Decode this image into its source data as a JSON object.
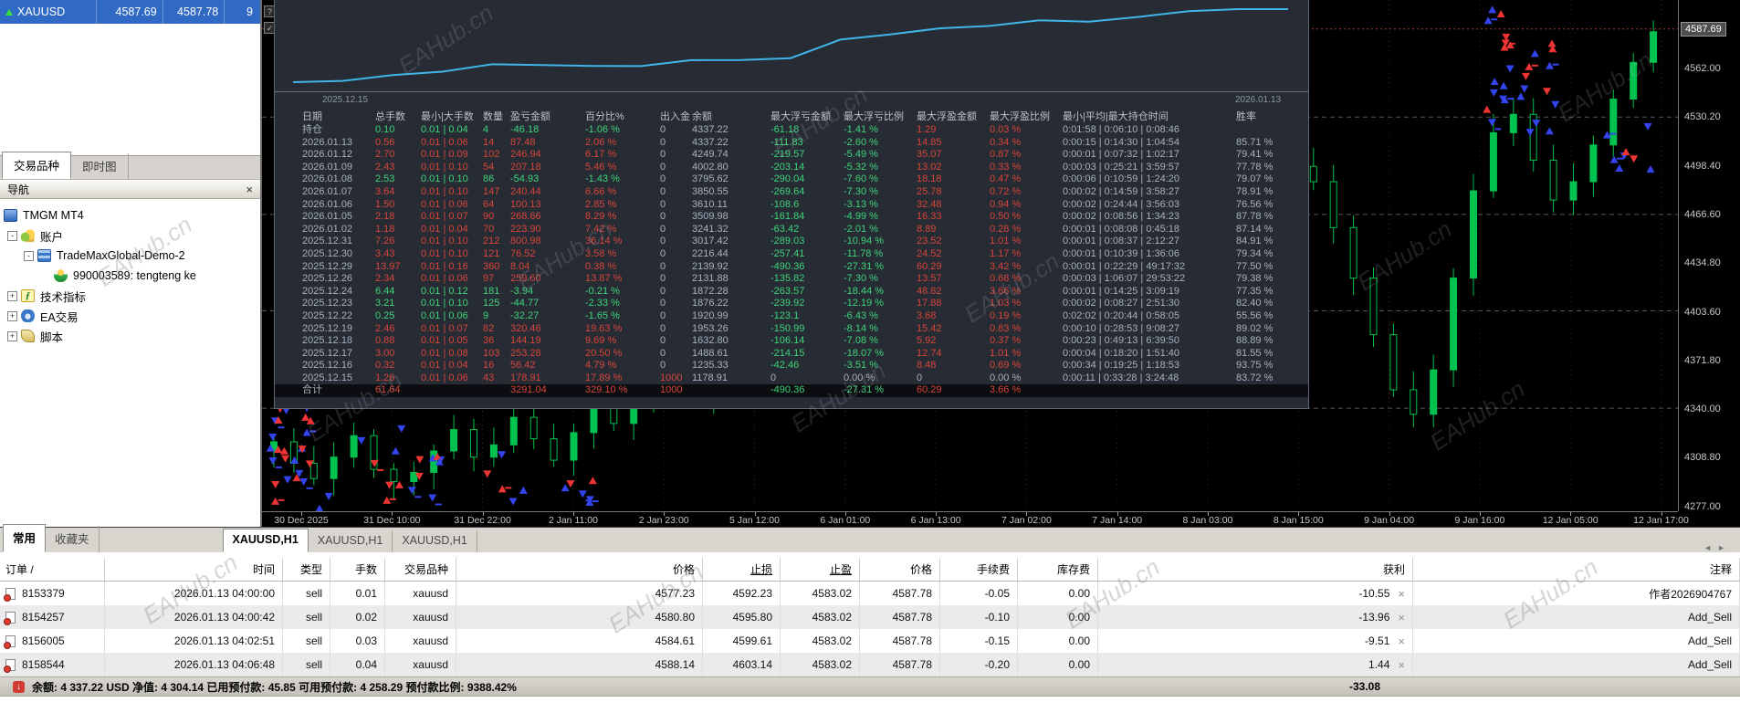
{
  "app": {
    "watermark": "EAHub.cn"
  },
  "market_watch": {
    "symbol": "XAUUSD",
    "bid": "4587.69",
    "ask": "4587.78",
    "spread": "9",
    "tabs": [
      {
        "label": "交易品种",
        "active": true
      },
      {
        "label": "即时图",
        "active": false
      }
    ]
  },
  "navigator": {
    "title": "导航",
    "close": "×",
    "tree": [
      {
        "label": "TMGM MT4",
        "icon": "platform-icon",
        "level": 0,
        "expander": ""
      },
      {
        "label": "账户",
        "icon": "accounts-icon",
        "level": 1,
        "expander": "-"
      },
      {
        "label": "TradeMaxGlobal-Demo-2",
        "icon": "server-icon",
        "level": 2,
        "expander": "-"
      },
      {
        "label": "990003589: tengteng ke",
        "icon": "account-icon",
        "level": 3,
        "expander": ""
      },
      {
        "label": "技术指标",
        "icon": "indicators-icon",
        "level": 1,
        "expander": "+"
      },
      {
        "label": "EA交易",
        "icon": "experts-icon",
        "level": 1,
        "expander": "+"
      },
      {
        "label": "脚本",
        "icon": "scripts-icon",
        "level": 1,
        "expander": "+"
      }
    ]
  },
  "tab_bar": {
    "left_tabs": [
      {
        "label": "常用",
        "active": true
      },
      {
        "label": "收藏夹",
        "active": false
      }
    ],
    "chart_tabs": [
      {
        "label": "XAUUSD,H1",
        "active": true
      },
      {
        "label": "XAUUSD,H1",
        "active": false
      },
      {
        "label": "XAUUSD,H1",
        "active": false
      }
    ],
    "scroll_left": "◄",
    "scroll_right": "►"
  },
  "stats_panel": {
    "start_date": "2025.12.15",
    "end_date": "2026.01.13",
    "headers": [
      "日期",
      "总手数",
      "最小|大手数",
      "数量",
      "盈亏金额",
      "百分比%",
      "出入金",
      "余额",
      "最大浮亏金额",
      "最大浮亏比例",
      "最大浮盈金额",
      "最大浮盈比例",
      "最小|平均|最大持仓时间",
      "胜率"
    ],
    "rows": [
      {
        "date": "持仓",
        "lots": "0.10",
        "minmax": "0.01 | 0.04",
        "cnt": "4",
        "pl": "-46.18",
        "pct": "-1.06 %",
        "io": "0",
        "bal": "4337.22",
        "mdd": "-61.18",
        "mddp": "-1.41 %",
        "mfp": "1.29",
        "mfpp": "0.03 %",
        "time": "0:01:58 | 0:06:10 | 0:08:46",
        "win": "",
        "cls": "loss"
      },
      {
        "date": "2026.01.13",
        "lots": "0.56",
        "minmax": "0.01 | 0.06",
        "cnt": "14",
        "pl": "87.48",
        "pct": "2.06 %",
        "io": "0",
        "bal": "4337.22",
        "mdd": "-111.83",
        "mddp": "-2.60 %",
        "mfp": "14.85",
        "mfpp": "0.34 %",
        "time": "0:00:15 | 0:14:30 | 1:04:54",
        "win": "85.71 %",
        "cls": "profit"
      },
      {
        "date": "2026.01.12",
        "lots": "2.70",
        "minmax": "0.01 | 0.09",
        "cnt": "102",
        "pl": "246.94",
        "pct": "6.17 %",
        "io": "0",
        "bal": "4249.74",
        "mdd": "-219.57",
        "mddp": "-5.49 %",
        "mfp": "35.07",
        "mfpp": "0.87 %",
        "time": "0:00:01 | 0:07:32 | 1:02:17",
        "win": "79.41 %",
        "cls": "profit"
      },
      {
        "date": "2026.01.09",
        "lots": "2.43",
        "minmax": "0.01 | 0.10",
        "cnt": "54",
        "pl": "207.18",
        "pct": "5.46 %",
        "io": "0",
        "bal": "4002.80",
        "mdd": "-203.14",
        "mddp": "-5.32 %",
        "mfp": "13.02",
        "mfpp": "0.33 %",
        "time": "0:00:03 | 0:25:21 | 3:59:57",
        "win": "77.78 %",
        "cls": "profit"
      },
      {
        "date": "2026.01.08",
        "lots": "2.53",
        "minmax": "0.01 | 0.10",
        "cnt": "86",
        "pl": "-54.93",
        "pct": "-1.43 %",
        "io": "0",
        "bal": "3795.62",
        "mdd": "-290.04",
        "mddp": "-7.60 %",
        "mfp": "18.18",
        "mfpp": "0.47 %",
        "time": "0:00:06 | 0:10:59 | 1:24:20",
        "win": "79.07 %",
        "cls": "loss"
      },
      {
        "date": "2026.01.07",
        "lots": "3.64",
        "minmax": "0.01 | 0.10",
        "cnt": "147",
        "pl": "240.44",
        "pct": "6.66 %",
        "io": "0",
        "bal": "3850.55",
        "mdd": "-269.64",
        "mddp": "-7.30 %",
        "mfp": "25.78",
        "mfpp": "0.72 %",
        "time": "0:00:02 | 0:14:59 | 3:58:27",
        "win": "78.91 %",
        "cls": "profit"
      },
      {
        "date": "2026.01.06",
        "lots": "1.50",
        "minmax": "0.01 | 0.06",
        "cnt": "64",
        "pl": "100.13",
        "pct": "2.85 %",
        "io": "0",
        "bal": "3610.11",
        "mdd": "-108.6",
        "mddp": "-3.13 %",
        "mfp": "32.48",
        "mfpp": "0.94 %",
        "time": "0:00:02 | 0:24:44 | 3:56:03",
        "win": "76.56 %",
        "cls": "profit"
      },
      {
        "date": "2026.01.05",
        "lots": "2.18",
        "minmax": "0.01 | 0.07",
        "cnt": "90",
        "pl": "268.66",
        "pct": "8.29 %",
        "io": "0",
        "bal": "3509.98",
        "mdd": "-161.84",
        "mddp": "-4.99 %",
        "mfp": "16.33",
        "mfpp": "0.50 %",
        "time": "0:00:02 | 0:08:56 | 1:34:23",
        "win": "87.78 %",
        "cls": "profit"
      },
      {
        "date": "2026.01.02",
        "lots": "1.18",
        "minmax": "0.01 | 0.04",
        "cnt": "70",
        "pl": "223.90",
        "pct": "7.42 %",
        "io": "0",
        "bal": "3241.32",
        "mdd": "-63.42",
        "mddp": "-2.01 %",
        "mfp": "8.89",
        "mfpp": "0.28 %",
        "time": "0:00:01 | 0:08:08 | 0:45:18",
        "win": "87.14 %",
        "cls": "profit"
      },
      {
        "date": "2025.12.31",
        "lots": "7.26",
        "minmax": "0.01 | 0.10",
        "cnt": "212",
        "pl": "800.98",
        "pct": "36.14 %",
        "io": "0",
        "bal": "3017.42",
        "mdd": "-289.03",
        "mddp": "-10.94 %",
        "mfp": "23.52",
        "mfpp": "1.01 %",
        "time": "0:00:01 | 0:08:37 | 2:12:27",
        "win": "84.91 %",
        "cls": "profit"
      },
      {
        "date": "2025.12.30",
        "lots": "3.43",
        "minmax": "0.01 | 0.10",
        "cnt": "121",
        "pl": "76.52",
        "pct": "3.58 %",
        "io": "0",
        "bal": "2216.44",
        "mdd": "-257.41",
        "mddp": "-11.78 %",
        "mfp": "24.52",
        "mfpp": "1.17 %",
        "time": "0:00:01 | 0:10:39 | 1:36:06",
        "win": "79.34 %",
        "cls": "profit"
      },
      {
        "date": "2025.12.29",
        "lots": "13.97",
        "minmax": "0.01 | 0.16",
        "cnt": "360",
        "pl": "8.04",
        "pct": "0.38 %",
        "io": "0",
        "bal": "2139.92",
        "mdd": "-490.36",
        "mddp": "-27.31 %",
        "mfp": "60.29",
        "mfpp": "3.42 %",
        "time": "0:00:01 | 0:22:29 | 49:17:32",
        "win": "77.50 %",
        "cls": "profit"
      },
      {
        "date": "2025.12.26",
        "lots": "2.34",
        "minmax": "0.01 | 0.06",
        "cnt": "97",
        "pl": "259.60",
        "pct": "13.87 %",
        "io": "0",
        "bal": "2131.88",
        "mdd": "-135.82",
        "mddp": "-7.30 %",
        "mfp": "13.57",
        "mfpp": "0.68 %",
        "time": "0:00:03 | 1:06:07 | 29:53:22",
        "win": "79.38 %",
        "cls": "profit"
      },
      {
        "date": "2025.12.24",
        "lots": "6.44",
        "minmax": "0.01 | 0.12",
        "cnt": "181",
        "pl": "-3.94",
        "pct": "-0.21 %",
        "io": "0",
        "bal": "1872.28",
        "mdd": "-263.57",
        "mddp": "-18.44 %",
        "mfp": "48.82",
        "mfpp": "3.66 %",
        "time": "0:00:01 | 0:14:25 | 3:09:19",
        "win": "77.35 %",
        "cls": "loss"
      },
      {
        "date": "2025.12.23",
        "lots": "3.21",
        "minmax": "0.01 | 0.10",
        "cnt": "125",
        "pl": "-44.77",
        "pct": "-2.33 %",
        "io": "0",
        "bal": "1876.22",
        "mdd": "-239.92",
        "mddp": "-12.19 %",
        "mfp": "17.88",
        "mfpp": "1.03 %",
        "time": "0:00:02 | 0:08:27 | 2:51:30",
        "win": "82.40 %",
        "cls": "loss"
      },
      {
        "date": "2025.12.22",
        "lots": "0.25",
        "minmax": "0.01 | 0.06",
        "cnt": "9",
        "pl": "-32.27",
        "pct": "-1.65 %",
        "io": "0",
        "bal": "1920.99",
        "mdd": "-123.1",
        "mddp": "-6.43 %",
        "mfp": "3.68",
        "mfpp": "0.19 %",
        "time": "0:02:02 | 0:20:44 | 0:58:05",
        "win": "55.56 %",
        "cls": "loss"
      },
      {
        "date": "2025.12.19",
        "lots": "2.46",
        "minmax": "0.01 | 0.07",
        "cnt": "82",
        "pl": "320.46",
        "pct": "19.63 %",
        "io": "0",
        "bal": "1953.26",
        "mdd": "-150.99",
        "mddp": "-8.14 %",
        "mfp": "15.42",
        "mfpp": "0.83 %",
        "time": "0:00:10 | 0:28:53 | 9:08:27",
        "win": "89.02 %",
        "cls": "profit"
      },
      {
        "date": "2025.12.18",
        "lots": "0.88",
        "minmax": "0.01 | 0.05",
        "cnt": "36",
        "pl": "144.19",
        "pct": "9.69 %",
        "io": "0",
        "bal": "1632.80",
        "mdd": "-106.14",
        "mddp": "-7.08 %",
        "mfp": "5.92",
        "mfpp": "0.37 %",
        "time": "0:00:23 | 0:49:13 | 6:39:50",
        "win": "88.89 %",
        "cls": "profit"
      },
      {
        "date": "2025.12.17",
        "lots": "3.00",
        "minmax": "0.01 | 0.08",
        "cnt": "103",
        "pl": "253.28",
        "pct": "20.50 %",
        "io": "0",
        "bal": "1488.61",
        "mdd": "-214.15",
        "mddp": "-18.07 %",
        "mfp": "12.74",
        "mfpp": "1.01 %",
        "time": "0:00:04 | 0:18:20 | 1:51:40",
        "win": "81.55 %",
        "cls": "profit"
      },
      {
        "date": "2025.12.16",
        "lots": "0.32",
        "minmax": "0.01 | 0.04",
        "cnt": "16",
        "pl": "56.42",
        "pct": "4.79 %",
        "io": "0",
        "bal": "1235.33",
        "mdd": "-42.46",
        "mddp": "-3.51 %",
        "mfp": "8.48",
        "mfpp": "0.69 %",
        "time": "0:00:34 | 0:19:25 | 1:18:53",
        "win": "93.75 %",
        "cls": "profit"
      },
      {
        "date": "2025.12.15",
        "lots": "1.26",
        "minmax": "0.01 | 0.06",
        "cnt": "43",
        "pl": "178.91",
        "pct": "17.89 %",
        "io": "1000",
        "bal": "1178.91",
        "mdd": "0",
        "mddp": "0.00 %",
        "mfp": "0",
        "mfpp": "0.00 %",
        "time": "0:00:11 | 0:33:28 | 3:24:48",
        "win": "83.72 %",
        "cls": "profit",
        "fneutral": true
      },
      {
        "date": "合计",
        "lots": "61.64",
        "minmax": "",
        "cnt": "",
        "pl": "3291.04",
        "pct": "329.10 %",
        "io": "1000",
        "bal": "",
        "mdd": "-490.36",
        "mddp": "-27.31 %",
        "mfp": "60.29",
        "mfpp": "3.66 %",
        "time": "",
        "win": "",
        "cls": "profit",
        "total": true
      }
    ]
  },
  "chart": {
    "price_axis": {
      "current": "4587.69",
      "labels": [
        "4562.00",
        "4530.20",
        "4498.40",
        "4466.60",
        "4434.80",
        "4403.60",
        "4371.80",
        "4340.00",
        "4308.80",
        "4277.00"
      ]
    },
    "time_axis": [
      "30 Dec 2025",
      "31 Dec 10:00",
      "31 Dec 22:00",
      "2 Jan 11:00",
      "2 Jan 23:00",
      "5 Jan 12:00",
      "6 Jan 01:00",
      "6 Jan 13:00",
      "7 Jan 02:00",
      "7 Jan 14:00",
      "8 Jan 03:00",
      "8 Jan 15:00",
      "9 Jan 04:00",
      "9 Jan 16:00",
      "12 Jan 05:00",
      "12 Jan 17:00"
    ]
  },
  "chart_data": {
    "type": "line",
    "title": "equity-curve",
    "x_start_label": "2025.12.15",
    "x_end_label": "2026.01.13",
    "equity_points": [
      1178.91,
      1235.33,
      1488.61,
      1632.8,
      1953.26,
      1920.99,
      1876.22,
      1872.28,
      2131.88,
      2139.92,
      2216.44,
      3017.42,
      3241.32,
      3509.98,
      3610.11,
      3850.55,
      3795.62,
      4002.8,
      4249.74,
      4337.22,
      4337.22
    ],
    "equity_range": [
      1178.91,
      4337.22
    ],
    "candles_close": [
      4318,
      4304,
      4294,
      4308,
      4322,
      4300,
      4292,
      4298,
      4312,
      4326,
      4308,
      4316,
      4334,
      4320,
      4306,
      4324,
      4340,
      4330,
      4345,
      4352,
      4360,
      4348,
      4372,
      4384,
      4368,
      4392,
      4404,
      4388,
      4412,
      4424,
      4408,
      4432,
      4444,
      4428,
      4452,
      4446,
      4462,
      4472,
      4456,
      4482,
      4476,
      4492,
      4502,
      4486,
      4496,
      4512,
      4506,
      4496,
      4486,
      4492,
      4502,
      4498,
      4488,
      4458,
      4425,
      4388,
      4352,
      4336,
      4365,
      4425,
      4482,
      4520,
      4532,
      4502,
      4476,
      4488,
      4512,
      4542,
      4566,
      4586
    ],
    "ylim": [
      4277.0,
      4587.69
    ]
  },
  "orders": {
    "headers": [
      "订单 /",
      "时间",
      "类型",
      "手数",
      "交易品种",
      "价格",
      "止损",
      "止盈",
      "价格",
      "手续费",
      "库存费",
      "获利",
      "注释"
    ],
    "rows": [
      {
        "id": "8153379",
        "time": "2026.01.13 04:00:00",
        "type": "sell",
        "lots": "0.01",
        "symbol": "xauusd",
        "price": "4577.23",
        "sl": "4592.23",
        "tp": "4583.02",
        "price2": "4587.78",
        "commission": "-0.05",
        "swap": "0.00",
        "profit": "-10.55",
        "comment": "作者2026904767"
      },
      {
        "id": "8154257",
        "time": "2026.01.13 04:00:42",
        "type": "sell",
        "lots": "0.02",
        "symbol": "xauusd",
        "price": "4580.80",
        "sl": "4595.80",
        "tp": "4583.02",
        "price2": "4587.78",
        "commission": "-0.10",
        "swap": "0.00",
        "profit": "-13.96",
        "comment": "Add_Sell"
      },
      {
        "id": "8156005",
        "time": "2026.01.13 04:02:51",
        "type": "sell",
        "lots": "0.03",
        "symbol": "xauusd",
        "price": "4584.61",
        "sl": "4599.61",
        "tp": "4583.02",
        "price2": "4587.78",
        "commission": "-0.15",
        "swap": "0.00",
        "profit": "-9.51",
        "comment": "Add_Sell"
      },
      {
        "id": "8158544",
        "time": "2026.01.13 04:06:48",
        "type": "sell",
        "lots": "0.04",
        "symbol": "xauusd",
        "price": "4588.14",
        "sl": "4603.14",
        "tp": "4583.02",
        "price2": "4587.78",
        "commission": "-0.20",
        "swap": "0.00",
        "profit": "1.44",
        "comment": "Add_Sell"
      }
    ],
    "close_glyph": "×"
  },
  "status_bar": {
    "text": "余额: 4 337.22 USD  净值: 4 304.14  已用预付款: 45.85  可用预付款: 4 258.29  预付款比例: 9388.42%",
    "total_profit": "-33.08"
  },
  "colors": {
    "profit_red": "#d8453a",
    "loss_green": "#3fd47a",
    "dim_text": "#a9b2bf",
    "equity_line": "#3fb5e8",
    "candle_green": "#00c24e",
    "buy_arrow": "#3344ee",
    "sell_arrow": "#ee3333",
    "selected_row_bg": "#316ac5"
  }
}
